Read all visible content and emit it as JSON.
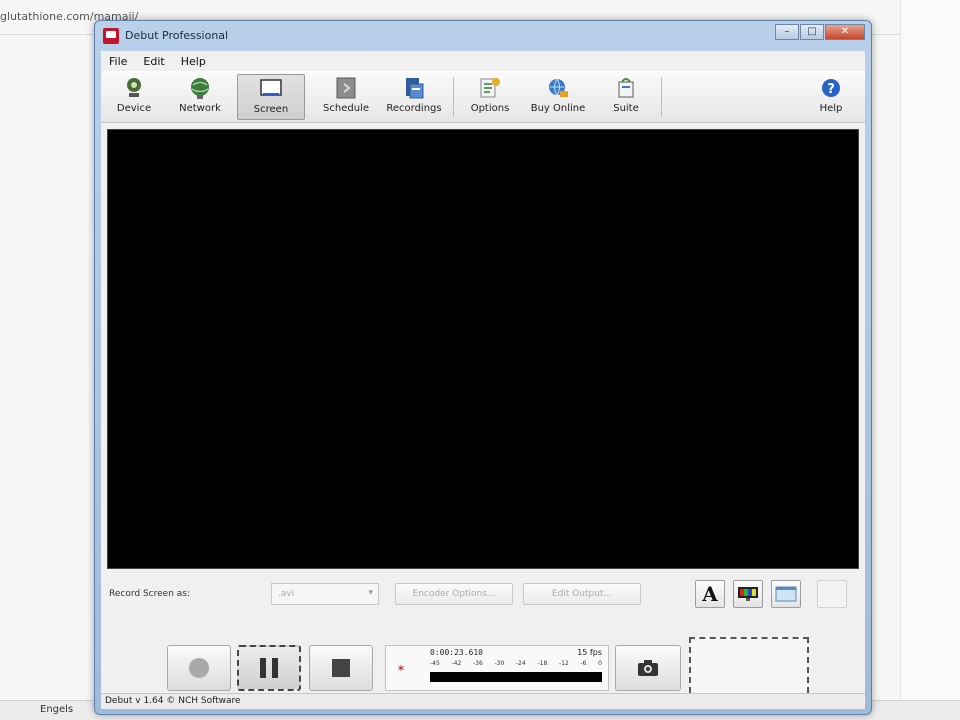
{
  "background": {
    "url_text": "glutathione.com/mamaji/",
    "taskbar_item": "Engels"
  },
  "window": {
    "title": "Debut Professional",
    "controls": {
      "minimize": "–",
      "maximize": "□",
      "close": "✕"
    }
  },
  "menu": {
    "file": "File",
    "edit": "Edit",
    "help": "Help"
  },
  "toolbar": {
    "device": "Device",
    "network": "Network",
    "screen": "Screen",
    "schedule": "Schedule",
    "recordings": "Recordings",
    "options": "Options",
    "buy_online": "Buy Online",
    "suite": "Suite",
    "help": "Help",
    "active": "screen"
  },
  "record_options": {
    "label": "Record Screen as:",
    "format_value": ".avi",
    "encoder_button": "Encoder Options...",
    "output_button": "Edit Output..."
  },
  "text_overlay_glyph": "A",
  "meter": {
    "icon_glyph": "✶",
    "time": "0:00:23.610",
    "fps": "15 fps",
    "scale": [
      "-45",
      "-42",
      "-36",
      "-30",
      "-24",
      "-18",
      "-12",
      "-6",
      "0"
    ]
  },
  "status": {
    "text": "Debut v 1.64 © NCH Software"
  },
  "colors": {
    "title_bar": "#b8d0ea",
    "viewer": "#000000",
    "close_button": "#c4452a"
  }
}
